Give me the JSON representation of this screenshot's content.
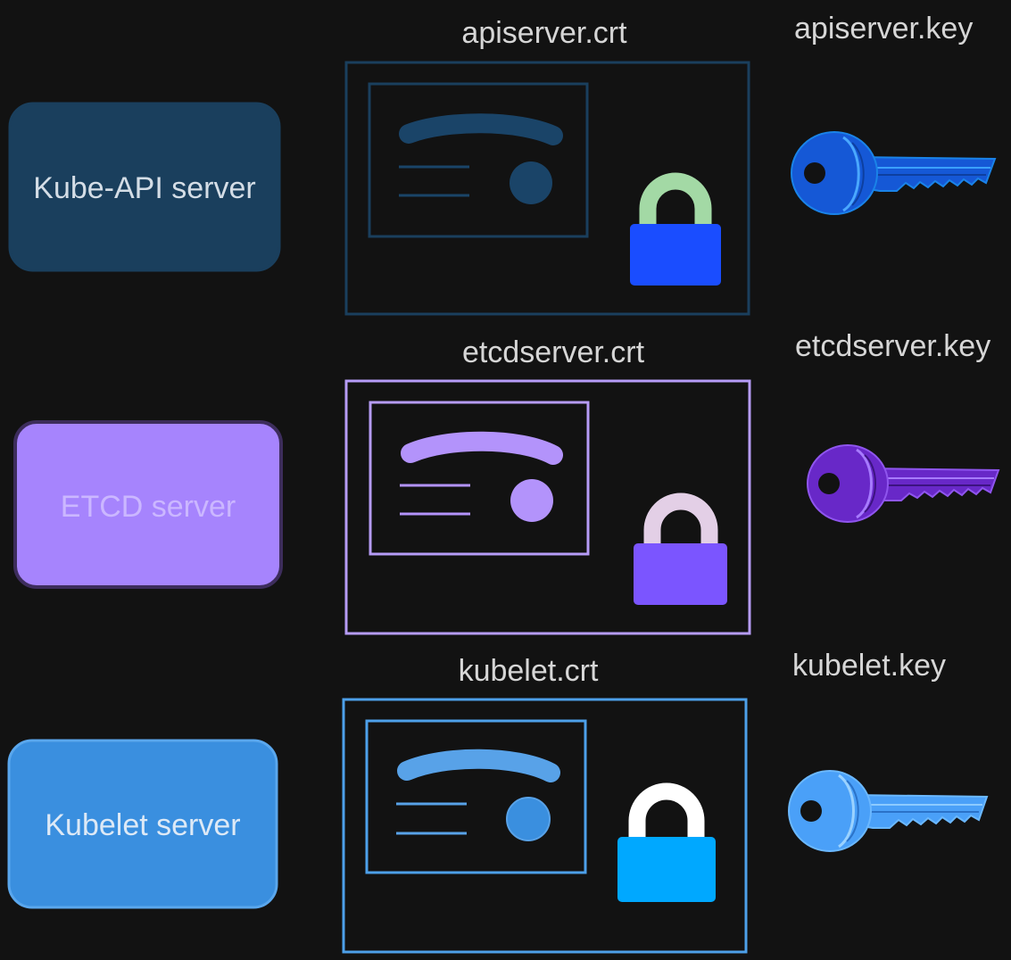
{
  "rows": [
    {
      "id": "kube-api",
      "server_label": "Kube-API server",
      "cert_label": "apiserver.crt",
      "key_label": "apiserver.key",
      "colors": {
        "server_fill": "#1a3f5d",
        "server_stroke": "#1a3f5d",
        "server_text": "#d4dde6",
        "cert_stroke": "#1a3f5d",
        "cert_accent": "#1a4468",
        "lock_shackle": "#a3d9a5",
        "lock_body": "#1a4dff",
        "key_fill": "#1558d6",
        "key_edge": "#1a83e8"
      }
    },
    {
      "id": "etcd",
      "server_label": "ETCD server",
      "cert_label": "etcdserver.crt",
      "key_label": "etcdserver.key",
      "colors": {
        "server_fill": "#a684fd",
        "server_stroke": "#3d2d5c",
        "server_text": "#cbb7ff",
        "cert_stroke": "#b69cf7",
        "cert_accent": "#b393fb",
        "lock_shackle": "#e3cfe6",
        "lock_body": "#7b55ff",
        "key_fill": "#6828c8",
        "key_edge": "#8f55ee"
      }
    },
    {
      "id": "kubelet",
      "server_label": "Kubelet server",
      "cert_label": "kubelet.crt",
      "key_label": "kubelet.key",
      "colors": {
        "server_fill": "#3a8fdf",
        "server_stroke": "#5aa7ed",
        "server_text": "#dde9f6",
        "cert_stroke": "#4da0e9",
        "cert_accent": "#58a2e8",
        "lock_shackle": "#ffffff",
        "lock_body": "#00a8ff",
        "key_fill": "#4aa0f8",
        "key_edge": "#6bb8ff"
      }
    }
  ]
}
